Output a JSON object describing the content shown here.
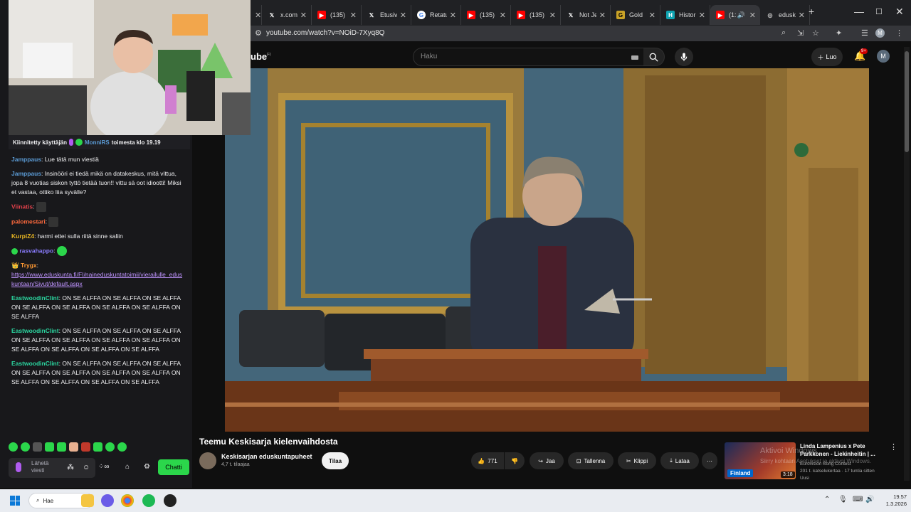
{
  "browser": {
    "tabs": [
      {
        "label": "x",
        "icon": "x-icon"
      },
      {
        "label": "x.com",
        "icon": "x-icon"
      },
      {
        "label": "(135)",
        "icon": "youtube-icon"
      },
      {
        "label": "Etusiv",
        "icon": "x-icon"
      },
      {
        "label": "Retatu",
        "icon": "google-icon"
      },
      {
        "label": "(135)",
        "icon": "youtube-icon"
      },
      {
        "label": "(135)",
        "icon": "youtube-icon"
      },
      {
        "label": "Not Je",
        "icon": "x-icon"
      },
      {
        "label": "Gold",
        "icon": "gold-icon"
      },
      {
        "label": "Histor",
        "icon": "histor-icon"
      },
      {
        "label": "(1:",
        "icon": "youtube-icon"
      },
      {
        "label": "edusk",
        "icon": "globe-icon"
      }
    ],
    "url": "youtube.com/watch?v=NOiD-7Xyq8Q"
  },
  "youtube": {
    "logo": "ube",
    "logo_region": "FI",
    "search_placeholder": "Haku",
    "create_label": "Luo",
    "notif_count": "9+",
    "avatar_letter": "M",
    "video_title": "Teemu Keskisarja kielenvaihdosta",
    "channel_name": "Keskisarjan eduskuntapuheet",
    "channel_subs": "4,7 t. tilaajaa",
    "subscribe_label": "Tilaa",
    "like_count": "771",
    "share_label": "Jaa",
    "save_label": "Tallenna",
    "clip_label": "Klippi",
    "download_label": "Lataa",
    "rec": {
      "title": "Linda Lampenius x Pete Parkkonen - Liekinheitin | ...",
      "channel": "Eurovision Song Contest",
      "meta": "201 t. katselukertaa · 17 tuntia sitten",
      "meta2": "Uusi",
      "flag": "Finland",
      "duration": "3:18"
    },
    "watermark_1": "Aktivoi Windows",
    "watermark_2": "Siirry kohtaan Asetukset ja aktivoi Windows."
  },
  "chat": {
    "pinned_prefix": "Kiinnitetty käyttäjän",
    "pinned_user": "MonniRS",
    "pinned_time": "toimesta klo 19.19",
    "messages": [
      {
        "user": "Jamppaus",
        "text": "Lue tätä mun viestiä",
        "color": "#5b9bd5"
      },
      {
        "user": "Jamppaus",
        "text": "Insinööri ei tiedä mikä on datakeskus, mitä vittua, jopa 8 vuotias siskon tyttö tietää tuon!! vittu sä oot idiootti! Miksi et vastaa, ottiko liia syvälle?",
        "color": "#5b9bd5"
      },
      {
        "user": "Viinatis",
        "text": "",
        "color": "#e0404a"
      },
      {
        "user": "palomestari",
        "text": "",
        "color": "#ff6a3d"
      },
      {
        "user": "KurpiZ4",
        "text": "harmi ettei sulla riitä sinne saliin",
        "color": "#e6b422"
      },
      {
        "user": "rasvahappo",
        "text": "",
        "color": "#8a7cff"
      },
      {
        "user": "Trygx",
        "text": "https://www.eduskunta.fi/FI/naineduskuntatoimii/vierailulle_eduskuntaan/Sivut/default.aspx",
        "color": "#ff9933"
      },
      {
        "user": "EastwoodinClint",
        "text": "ON SE ALFFA ON SE ALFFA ON SE ALFFA ON SE ALFFA ON SE ALFFA ON SE ALFFA ON SE ALFFA ON SE ALFFA",
        "color": "#2bd6a0"
      },
      {
        "user": "EastwoodinClint",
        "text": "ON SE ALFFA ON SE ALFFA ON SE ALFFA ON SE ALFFA ON SE ALFFA ON SE ALFFA ON SE ALFFA ON SE ALFFA ON SE ALFFA ON SE ALFFA ON SE ALFFA",
        "color": "#2bd6a0"
      },
      {
        "user": "EastwoodinClint",
        "text": "ON SE ALFFA ON SE ALFFA ON SE ALFFA ON SE ALFFA ON SE ALFFA ON SE ALFFA ON SE ALFFA ON SE ALFFA ON SE ALFFA ON SE ALFFA ON SE ALFFA",
        "color": "#2bd6a0"
      }
    ],
    "input_placeholder": "Lähetä viesti",
    "chat_button": "Chatti"
  },
  "taskbar": {
    "search_label": "Hae",
    "time": "19.57",
    "date": "1.3.2026"
  },
  "colors": {
    "twitch_green": "#2bd64b",
    "yt_bg": "#0f0f0f",
    "chat_bg": "#18181b"
  }
}
